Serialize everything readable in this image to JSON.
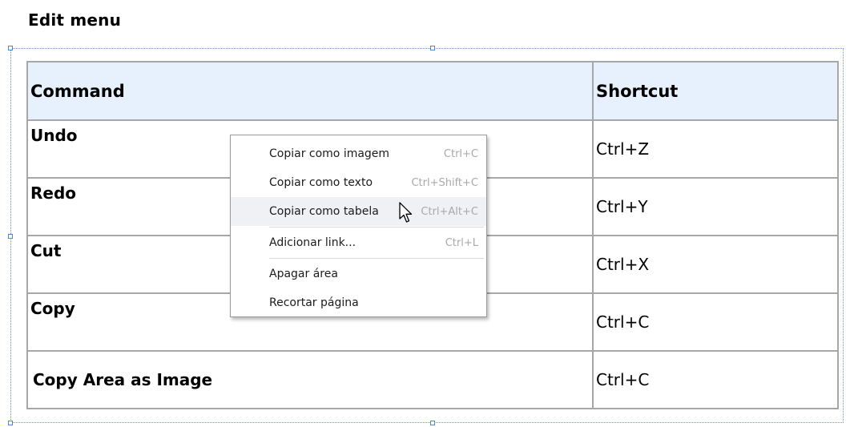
{
  "page": {
    "title": "Edit menu"
  },
  "table": {
    "headers": [
      "Command",
      "Shortcut"
    ],
    "rows": [
      {
        "command": "Undo",
        "shortcut": "Ctrl+Z"
      },
      {
        "command": "Redo",
        "shortcut": "Ctrl+Y"
      },
      {
        "command": "Cut",
        "shortcut": "Ctrl+X"
      },
      {
        "command": "Copy",
        "shortcut": "Ctrl+C"
      },
      {
        "command": "Copy Area as Image",
        "shortcut": "Ctrl+C"
      }
    ],
    "header_bg": "#e7f0fd",
    "border_color": "#a7a7a7"
  },
  "context_menu": {
    "items": [
      {
        "label": "Copiar como imagem",
        "shortcut": "Ctrl+C"
      },
      {
        "label": "Copiar como texto",
        "shortcut": "Ctrl+Shift+C"
      },
      {
        "label": "Copiar como tabela",
        "shortcut": "Ctrl+Alt+C",
        "hovered": true
      },
      {
        "label": "Adicionar link...",
        "shortcut": "Ctrl+L"
      },
      {
        "label": "Apagar área",
        "shortcut": ""
      },
      {
        "label": "Recortar página",
        "shortcut": ""
      }
    ],
    "hover_bg": "#eff1f4",
    "shortcut_color": "#a9a9a9"
  },
  "selection": {
    "handle_color": "#4f86d8"
  },
  "cursor": {
    "icon": "mouse-pointer-icon"
  }
}
